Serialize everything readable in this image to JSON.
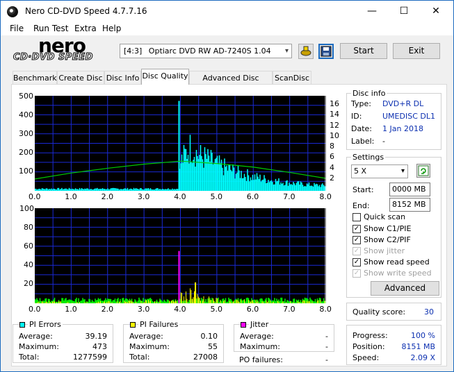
{
  "window": {
    "title": "Nero CD-DVD Speed 4.7.7.16",
    "minimize_glyph": "—",
    "maximize_glyph": "☐",
    "close_glyph": "✕"
  },
  "menu": [
    "File",
    "Run Test",
    "Extra",
    "Help"
  ],
  "logo": {
    "brand": "nero",
    "product": "CD·DVD SPEED"
  },
  "toolbar": {
    "drive_ratio": "[4:3]",
    "drive_name": "Optiarc DVD RW AD-7240S 1.04",
    "start_label": "Start",
    "exit_label": "Exit",
    "eject_icon": "eject-icon",
    "save_icon": "save-icon"
  },
  "tabs": [
    "Benchmark",
    "Create Disc",
    "Disc Info",
    "Disc Quality",
    "Advanced Disc Quality",
    "ScanDisc"
  ],
  "active_tab": "Disc Quality",
  "disc_info": {
    "title": "Disc info",
    "type_label": "Type:",
    "type_value": "DVD+R DL",
    "id_label": "ID:",
    "id_value": "UMEDISC DL1",
    "date_label": "Date:",
    "date_value": "1 Jan 2018",
    "label_label": "Label:",
    "label_value": "-"
  },
  "settings": {
    "title": "Settings",
    "speed": "5 X",
    "start_label": "Start:",
    "start_value": "0000 MB",
    "end_label": "End:",
    "end_value": "8152 MB",
    "quick_scan": "Quick scan",
    "show_c1pie": "Show C1/PIE",
    "show_c2pif": "Show C2/PIF",
    "show_jitter": "Show jitter",
    "show_read_speed": "Show read speed",
    "show_write_speed": "Show write speed",
    "advanced": "Advanced"
  },
  "quality": {
    "label": "Quality score:",
    "value": "30"
  },
  "progress": {
    "progress_label": "Progress:",
    "progress_value": "100 %",
    "position_label": "Position:",
    "position_value": "8151 MB",
    "speed_label": "Speed:",
    "speed_value": "2.09 X"
  },
  "stats": {
    "pi_errors": {
      "title": "PI Errors",
      "color": "#00ffff",
      "average_label": "Average:",
      "average": "39.19",
      "maximum_label": "Maximum:",
      "maximum": "473",
      "total_label": "Total:",
      "total": "1277599"
    },
    "pi_failures": {
      "title": "PI Failures",
      "color": "#ffff00",
      "average_label": "Average:",
      "average": "0.10",
      "maximum_label": "Maximum:",
      "maximum": "55",
      "total_label": "Total:",
      "total": "27008"
    },
    "jitter": {
      "title": "Jitter",
      "color": "#ff00ff",
      "average_label": "Average:",
      "average": "-",
      "maximum_label": "Maximum:",
      "maximum": "-"
    },
    "po_failures_label": "PO failures:",
    "po_failures": "-"
  },
  "chart_data": [
    {
      "type": "area",
      "name": "PI Errors",
      "x_ticks": [
        "0.0",
        "1.0",
        "2.0",
        "3.0",
        "4.0",
        "5.0",
        "6.0",
        "7.0",
        "8.0"
      ],
      "y_ticks_left": [
        "100",
        "200",
        "300",
        "400",
        "500"
      ],
      "y_ticks_right": [
        "2",
        "4",
        "6",
        "8",
        "10",
        "12",
        "14",
        "16"
      ],
      "xlim": [
        0,
        8
      ],
      "ylim": [
        0,
        500
      ],
      "y2lim": [
        0,
        16
      ],
      "grid": true,
      "fill_color": "#00ffff",
      "speed_color": "#00cc00",
      "series": [
        {
          "x": [
            0.0,
            0.5,
            1.0,
            1.5,
            2.0,
            2.5,
            3.0,
            3.5,
            3.95,
            4.0,
            4.2,
            4.3,
            4.5,
            4.7,
            5.0,
            5.5,
            6.0,
            6.5,
            7.0,
            7.5,
            8.0
          ],
          "y": [
            12,
            12,
            12,
            12,
            12,
            12,
            12,
            12,
            12,
            160,
            230,
            250,
            200,
            185,
            150,
            110,
            80,
            60,
            45,
            35,
            30
          ]
        }
      ],
      "read_speed": {
        "x": [
          0.0,
          1.0,
          2.0,
          3.0,
          4.0,
          5.0,
          6.0,
          7.0,
          8.0
        ],
        "y": [
          2.0,
          3.0,
          3.8,
          4.5,
          5.0,
          4.6,
          4.0,
          3.1,
          2.1
        ]
      },
      "spikes": [
        {
          "x": 4.0,
          "y": 473
        }
      ]
    },
    {
      "type": "bar",
      "name": "PI Failures",
      "x_ticks": [
        "0.0",
        "1.0",
        "2.0",
        "3.0",
        "4.0",
        "5.0",
        "6.0",
        "7.0",
        "8.0"
      ],
      "y_ticks_left": [
        "20",
        "40",
        "60",
        "80",
        "100"
      ],
      "xlim": [
        0,
        8
      ],
      "ylim": [
        0,
        100
      ],
      "grid": true,
      "fill_color": "#ffff00",
      "baseline_color": "#00ff00",
      "series": [
        {
          "x": [
            0.0,
            1.0,
            2.0,
            3.0,
            3.95,
            4.0,
            4.1,
            4.3,
            4.5,
            5.0,
            6.0,
            7.0,
            8.0
          ],
          "y": [
            2,
            2,
            2,
            3,
            3,
            20,
            12,
            14,
            8,
            5,
            3,
            2,
            4
          ]
        }
      ],
      "spikes": [
        {
          "x": 4.0,
          "y": 55,
          "color": "#ff00ff"
        },
        {
          "x": 4.45,
          "y": 22,
          "color": "#ffff00"
        }
      ]
    }
  ]
}
